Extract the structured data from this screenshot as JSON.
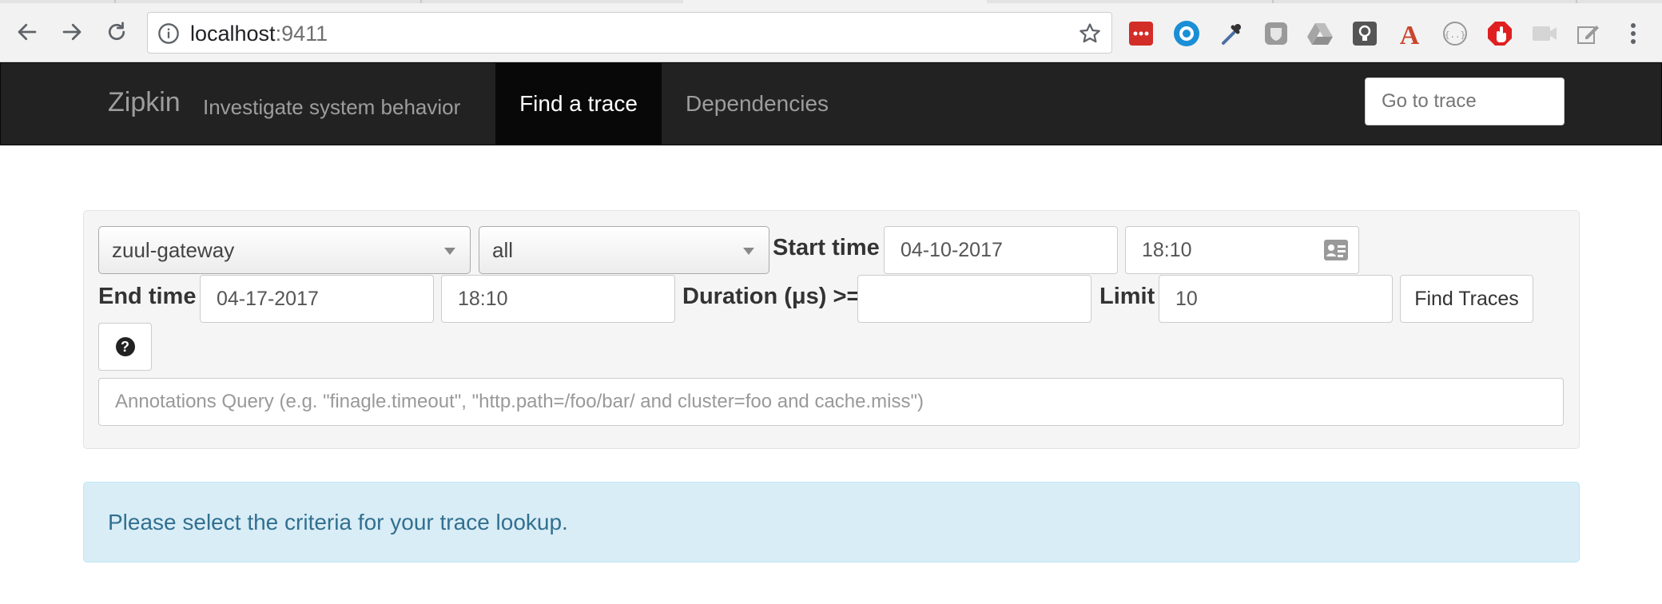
{
  "browser": {
    "url_host": "localhost",
    "url_port": ":9411",
    "extensions": [
      "lastpass-icon",
      "circle-icon",
      "eyedropper-icon",
      "shield-icon",
      "drive-icon",
      "bulb-icon",
      "font-icon",
      "json-icon",
      "adblock-icon",
      "camera-icon",
      "edit-icon"
    ]
  },
  "navbar": {
    "brand": "Zipkin",
    "tagline": "Investigate system behavior",
    "tabs": [
      {
        "label": "Find a trace",
        "active": true
      },
      {
        "label": "Dependencies",
        "active": false
      }
    ],
    "goto_placeholder": "Go to trace"
  },
  "search": {
    "service": "zuul-gateway",
    "span": "all",
    "start_time_label": "Start time",
    "start_date": "04-10-2017",
    "start_time": "18:10",
    "end_time_label": "End time",
    "end_date": "04-17-2017",
    "end_time": "18:10",
    "duration_label": "Duration (μs) >=",
    "duration_value": "",
    "limit_label": "Limit",
    "limit_value": "10",
    "find_button": "Find Traces",
    "help_symbol": "?",
    "annotation_placeholder": "Annotations Query (e.g. \"finagle.timeout\", \"http.path=/foo/bar/ and cluster=foo and cache.miss\")"
  },
  "alert": {
    "message": "Please select the criteria for your trace lookup."
  },
  "colors": {
    "navbar_bg": "#222222",
    "active_tab_bg": "#080808",
    "alert_bg": "#d9edf7",
    "alert_text": "#31708f"
  }
}
